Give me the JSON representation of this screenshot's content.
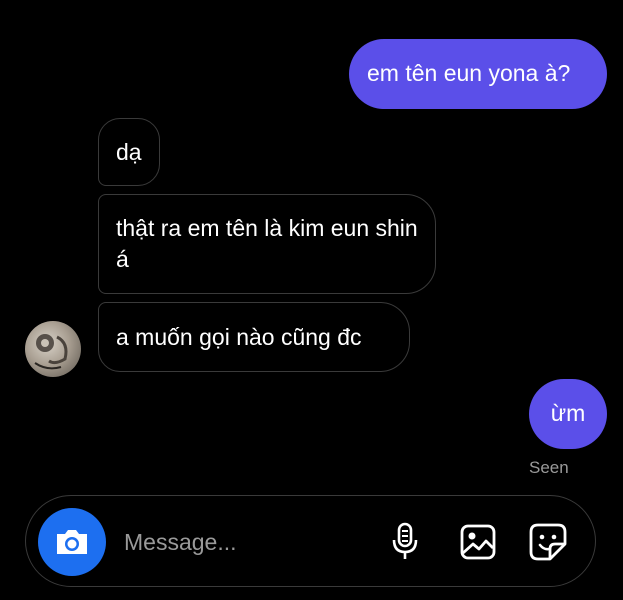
{
  "messages": [
    {
      "direction": "outgoing",
      "text": "em tên eun yona à?"
    },
    {
      "direction": "incoming",
      "text": "dạ"
    },
    {
      "direction": "incoming",
      "text": "thật ra em tên là kim eun shin á"
    },
    {
      "direction": "incoming",
      "text": "a muốn gọi nào cũng đc"
    },
    {
      "direction": "outgoing",
      "text": "ừm"
    }
  ],
  "status": {
    "seen": "Seen"
  },
  "composer": {
    "placeholder": "Message..."
  },
  "icons": {
    "camera": "camera-icon",
    "mic": "microphone-icon",
    "gallery": "image-icon",
    "sticker": "sticker-icon"
  },
  "colors": {
    "outgoing_bubble": "#5b4fe9",
    "camera_button": "#1d6ff0",
    "background": "#000000",
    "incoming_border": "#3a3a3a"
  }
}
